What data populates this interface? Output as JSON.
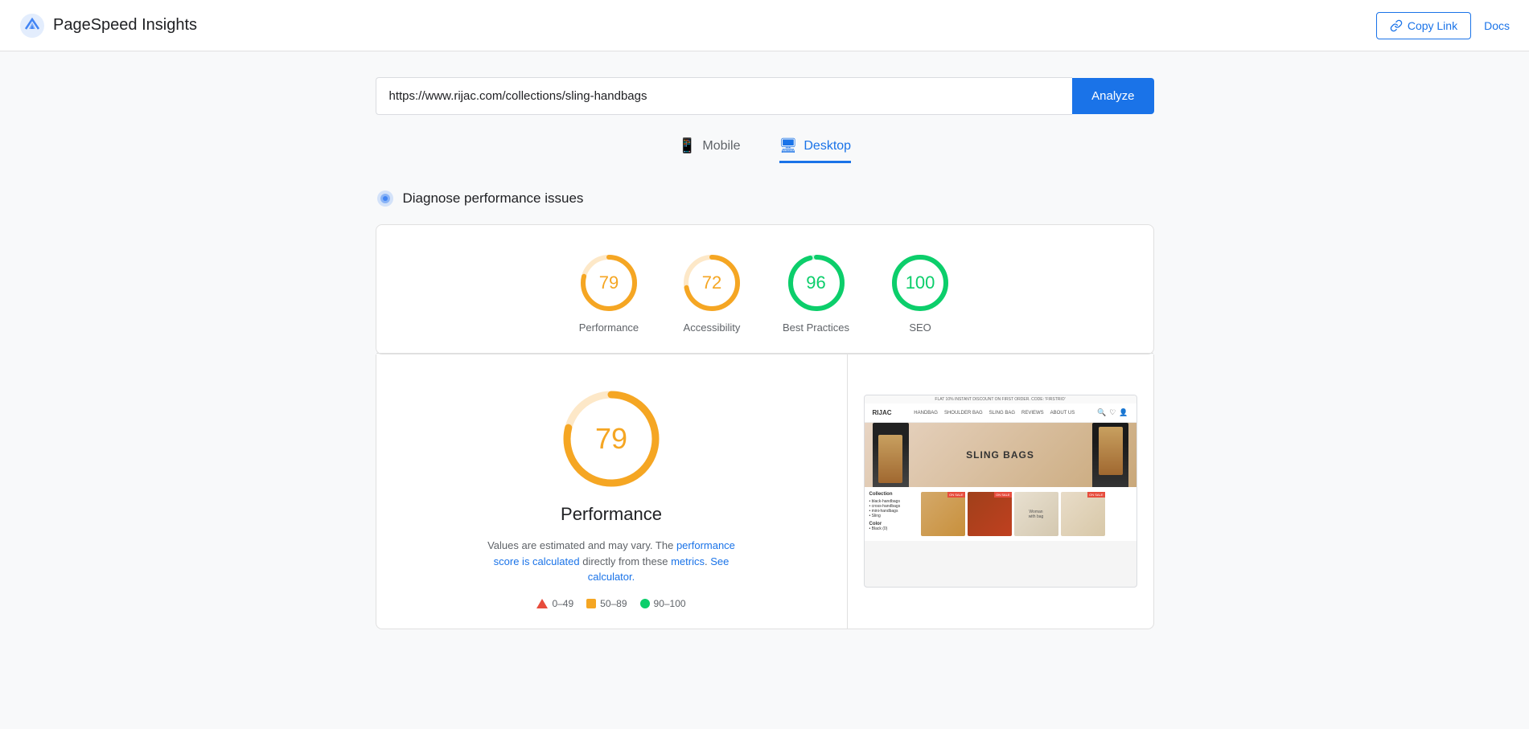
{
  "header": {
    "logo_alt": "PageSpeed Insights",
    "title": "PageSpeed Insights",
    "copy_link_label": "Copy Link",
    "docs_label": "Docs"
  },
  "url_bar": {
    "url_value": "https://www.rijac.com/collections/sling-handbags",
    "analyze_label": "Analyze"
  },
  "tabs": [
    {
      "id": "mobile",
      "label": "Mobile",
      "icon": "📱",
      "active": false
    },
    {
      "id": "desktop",
      "label": "Desktop",
      "icon": "🖥",
      "active": true
    }
  ],
  "section": {
    "title": "Diagnose performance issues"
  },
  "scores": [
    {
      "id": "performance",
      "value": 79,
      "label": "Performance",
      "color": "#f5a623",
      "track_color": "#fde8c8",
      "radius": 32,
      "stroke": 6
    },
    {
      "id": "accessibility",
      "value": 72,
      "label": "Accessibility",
      "color": "#f5a623",
      "track_color": "#fde8c8",
      "radius": 32,
      "stroke": 6
    },
    {
      "id": "best-practices",
      "value": 96,
      "label": "Best Practices",
      "color": "#0cce6b",
      "track_color": "#c8f7e0",
      "radius": 32,
      "stroke": 6
    },
    {
      "id": "seo",
      "value": 100,
      "label": "SEO",
      "color": "#0cce6b",
      "track_color": "#c8f7e0",
      "radius": 32,
      "stroke": 6
    }
  ],
  "performance_detail": {
    "score": 79,
    "title": "Performance",
    "note_prefix": "Values are estimated and may vary. The",
    "note_link1": "performance score is calculated",
    "note_middle": "directly from these",
    "note_link2": "metrics",
    "note_suffix": ". See calculator.",
    "color": "#f5a623",
    "track_color": "#fde8c8"
  },
  "legend": [
    {
      "id": "fail",
      "range": "0–49",
      "type": "triangle",
      "color": "#e74c3c"
    },
    {
      "id": "average",
      "range": "50–89",
      "type": "square",
      "color": "#f5a623"
    },
    {
      "id": "pass",
      "range": "90–100",
      "type": "circle",
      "color": "#0cce6b"
    }
  ],
  "screenshot": {
    "top_bar_text": "FLAT 10% INSTANT DISCOUNT ON FIRST ORDER. CODE: 'FIRSTRIO'",
    "logo": "RIJAC",
    "nav_items": [
      "HANDBAG",
      "SHOULDER BAG",
      "SLING BAG",
      "REVIEWS",
      "ABOUT US"
    ],
    "banner_text": "SLING BAGS",
    "collection_label": "Collection",
    "collection_items": [
      "black-handbags",
      "cross-handbags",
      "mini-handbags",
      "Sling"
    ]
  }
}
